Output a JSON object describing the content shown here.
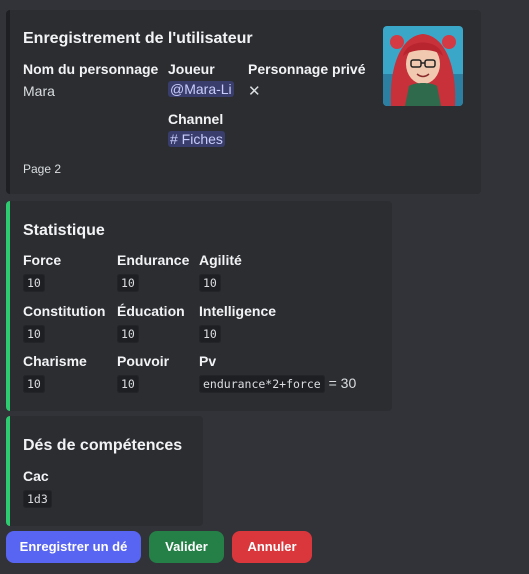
{
  "embed1": {
    "title": "Enregistrement de l'utilisateur",
    "fields": {
      "name_label": "Nom du personnage",
      "name_value": "Mara",
      "player_label": "Joueur",
      "player_value": "@Mara-Li",
      "private_label": "Personnage privé",
      "private_value": "✕",
      "channel_label": "Channel",
      "channel_value": "# Fiches"
    },
    "footer": "Page 2"
  },
  "embed2": {
    "title": "Statistique",
    "stats": [
      {
        "label": "Force",
        "value": "10"
      },
      {
        "label": "Endurance",
        "value": "10"
      },
      {
        "label": "Agilité",
        "value": "10"
      },
      {
        "label": "Constitution",
        "value": "10"
      },
      {
        "label": "Éducation",
        "value": "10"
      },
      {
        "label": "Intelligence",
        "value": "10"
      },
      {
        "label": "Charisme",
        "value": "10"
      },
      {
        "label": "Pouvoir",
        "value": "10"
      },
      {
        "label": "Pv",
        "value": "endurance*2+force",
        "result": "= 30"
      }
    ]
  },
  "embed3": {
    "title": "Dés de compétences",
    "skills": [
      {
        "label": "Cac",
        "value": "1d3"
      }
    ]
  },
  "buttons": {
    "register": "Enregistrer un dé",
    "validate": "Valider",
    "cancel": "Annuler"
  },
  "colors": {
    "accent_blurple": "#5865f2",
    "success": "#248046",
    "danger": "#da373c",
    "embed_stripe": "#2ecc71"
  }
}
